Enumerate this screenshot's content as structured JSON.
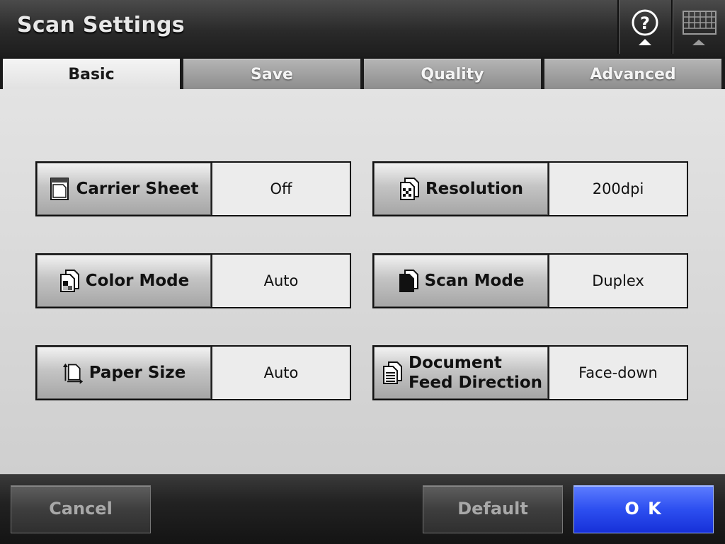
{
  "header": {
    "title": "Scan Settings",
    "help_icon": "question-icon",
    "keyboard_icon": "keyboard-icon"
  },
  "tabs": [
    {
      "label": "Basic",
      "active": true
    },
    {
      "label": "Save",
      "active": false
    },
    {
      "label": "Quality",
      "active": false
    },
    {
      "label": "Advanced",
      "active": false
    }
  ],
  "settings": [
    {
      "label": "Carrier Sheet",
      "value": "Off",
      "icon": "carrier-sheet-icon"
    },
    {
      "label": "Resolution",
      "value": "200dpi",
      "icon": "resolution-icon"
    },
    {
      "label": "Color Mode",
      "value": "Auto",
      "icon": "color-mode-icon"
    },
    {
      "label": "Scan Mode",
      "value": "Duplex",
      "icon": "scan-mode-icon"
    },
    {
      "label": "Paper Size",
      "value": "Auto",
      "icon": "paper-size-icon"
    },
    {
      "label_line1": "Document",
      "label_line2": "Feed Direction",
      "value": "Face-down",
      "icon": "document-feed-icon"
    }
  ],
  "footer": {
    "cancel": "Cancel",
    "default": "Default",
    "ok": "O K"
  },
  "colors": {
    "ok_button": "#2d4ff0",
    "header_bg": "#2a2a2a"
  }
}
